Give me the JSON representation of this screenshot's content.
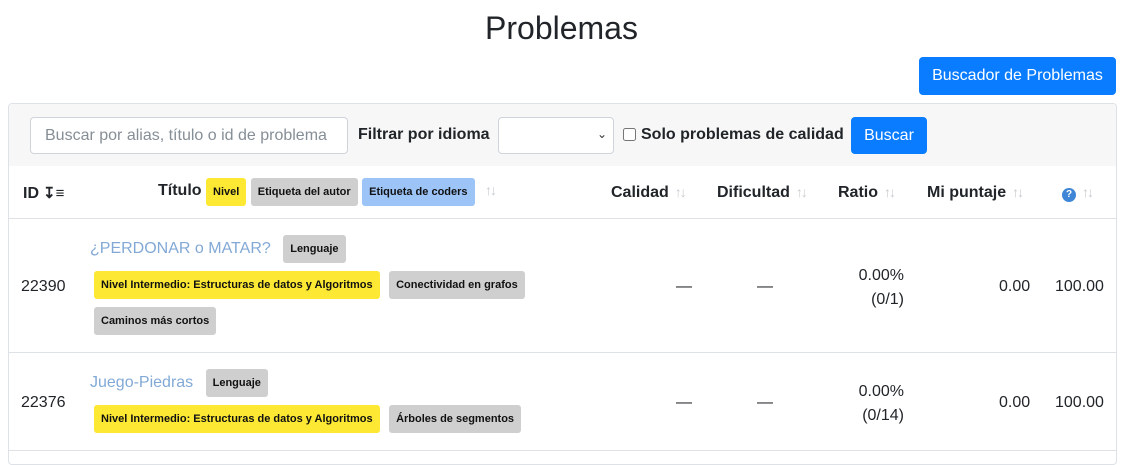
{
  "page": {
    "title": "Problemas",
    "finder_button": "Buscador de Problemas"
  },
  "filters": {
    "search_placeholder": "Buscar por alias, título o id de problema",
    "language_label": "Filtrar por idioma",
    "language_value": "",
    "quality_label": "Solo problemas de calidad",
    "search_button": "Buscar"
  },
  "table": {
    "headers": {
      "id": "ID",
      "title": "Título",
      "badge_level": "Nivel",
      "badge_author": "Etiqueta del autor",
      "badge_coders": "Etiqueta de coders",
      "quality": "Calidad",
      "difficulty": "Dificultad",
      "ratio": "Ratio",
      "my_score": "Mi puntaje",
      "help_icon": "?"
    },
    "rows": [
      {
        "id": "22390",
        "title": "¿PERDONAR o MATAR?",
        "tags": [
          "Lenguaje",
          "Nivel Intermedio: Estructuras de datos y Algoritmos",
          "Conectividad en grafos",
          "Caminos más cortos"
        ],
        "quality": "—",
        "difficulty": "—",
        "ratio": "0.00%",
        "ratio_detail": "(0/1)",
        "my_score": "0.00",
        "points": "100.00"
      },
      {
        "id": "22376",
        "title": "Juego-Piedras",
        "tags": [
          "Lenguaje",
          "Nivel Intermedio: Estructuras de datos y Algoritmos",
          "Árboles de segmentos"
        ],
        "quality": "—",
        "difficulty": "—",
        "ratio": "0.00%",
        "ratio_detail": "(0/14)",
        "my_score": "0.00",
        "points": "100.00"
      }
    ]
  },
  "colors": {
    "primary": "#0a7cff",
    "level_badge": "#fde933",
    "author_badge": "#cfcfcf",
    "coders_badge": "#9cc4f7",
    "link": "#82a9d6"
  }
}
